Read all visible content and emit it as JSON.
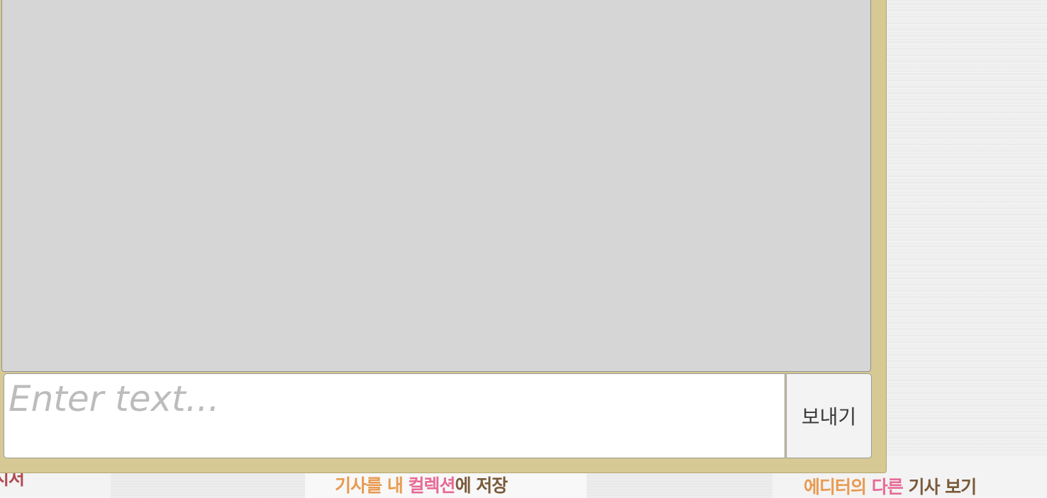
{
  "chat": {
    "input_placeholder": "Enter text...",
    "input_value": "",
    "send_label": "보내기"
  },
  "footer_links": {
    "partial_edge": "시저",
    "save_article": {
      "part1": "기사를 내 ",
      "part2": "컬렉션",
      "part3": "에 저장"
    },
    "other_articles": {
      "part1": "에디터의 ",
      "part2": "다른 ",
      "part3": "기사 보기"
    }
  },
  "colors": {
    "panel_bg": "#d6c994",
    "message_area_bg": "#d6d6d6",
    "link_orange": "#e89a50",
    "link_pink": "#e86a96",
    "link_brown": "#7a5a3a"
  }
}
